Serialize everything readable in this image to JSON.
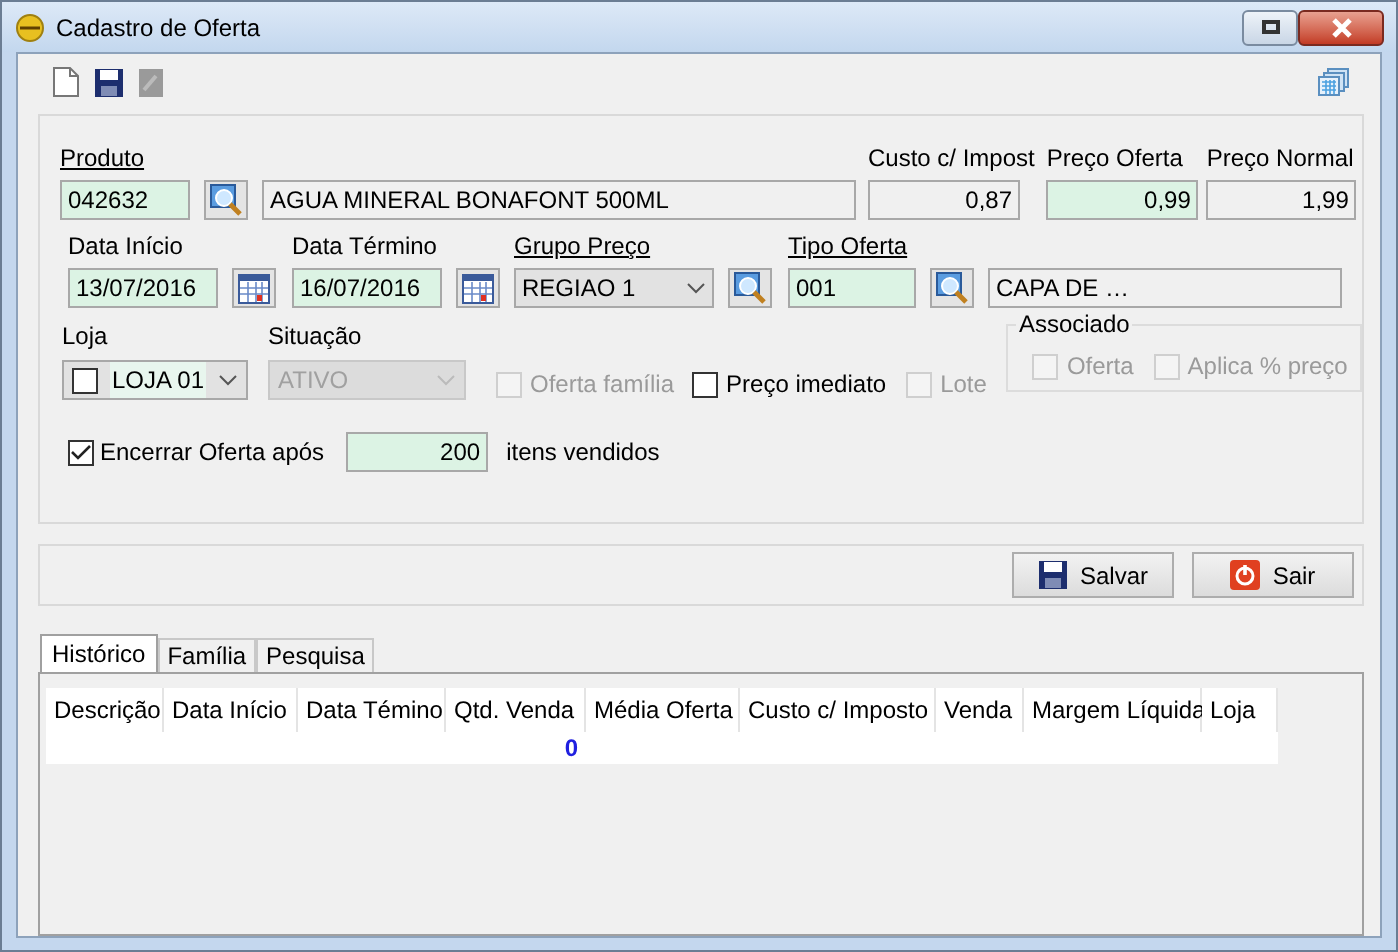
{
  "window": {
    "title": "Cadastro de Oferta"
  },
  "produto": {
    "label": "Produto",
    "underlined": true,
    "code": "042632",
    "description": "AGUA MINERAL BONAFONT 500ML"
  },
  "prices": [
    {
      "label": "Custo c/ Impost",
      "value": "0,87",
      "editable": false
    },
    {
      "label": "Preço Oferta",
      "value": "0,99",
      "editable": true
    },
    {
      "label": "Preço Normal",
      "value": "1,99",
      "editable": false
    }
  ],
  "data_inicio": {
    "label": "Data Início",
    "underlined": false,
    "value": "13/07/2016"
  },
  "data_termino": {
    "label": "Data Término",
    "underlined": false,
    "value": "16/07/2016"
  },
  "grupo_preco": {
    "label": "Grupo Preço",
    "underlined": true,
    "value": "REGIAO 1"
  },
  "tipo_oferta": {
    "label": "Tipo Oferta",
    "underlined": true,
    "code": "001",
    "description": "CAPA DE …"
  },
  "loja": {
    "label": "Loja",
    "value": "LOJA 01",
    "checked": false
  },
  "situacao": {
    "label": "Situação",
    "value": "ATIVO",
    "disabled": true
  },
  "options": [
    {
      "label": "Oferta família",
      "checked": false,
      "disabled": true
    },
    {
      "label": "Preço imediato",
      "checked": false,
      "disabled": false
    },
    {
      "label": "Lote",
      "checked": false,
      "disabled": true
    }
  ],
  "associado": {
    "title": "Associado",
    "options": [
      {
        "label": "Oferta",
        "checked": false,
        "disabled": true
      },
      {
        "label": "Aplica % preço",
        "checked": false,
        "disabled": true
      }
    ]
  },
  "encerrar": {
    "label": "Encerrar Oferta após",
    "checked": true,
    "value": "200",
    "suffix": "itens vendidos"
  },
  "buttons": [
    {
      "label": "Salvar",
      "kind": "save"
    },
    {
      "label": "Sair",
      "kind": "exit"
    }
  ],
  "tabs": [
    {
      "label": "Histórico",
      "selected": true
    },
    {
      "label": "Família",
      "selected": false
    },
    {
      "label": "Pesquisa",
      "selected": false
    }
  ],
  "table": {
    "columns": [
      "Descrição",
      "Data Início",
      "Data Témino",
      "Qtd. Venda",
      "Média Oferta",
      "Custo c/ Imposto",
      "Venda",
      "Margem Líquida",
      "Loja"
    ],
    "total_qtd_venda": "0"
  }
}
